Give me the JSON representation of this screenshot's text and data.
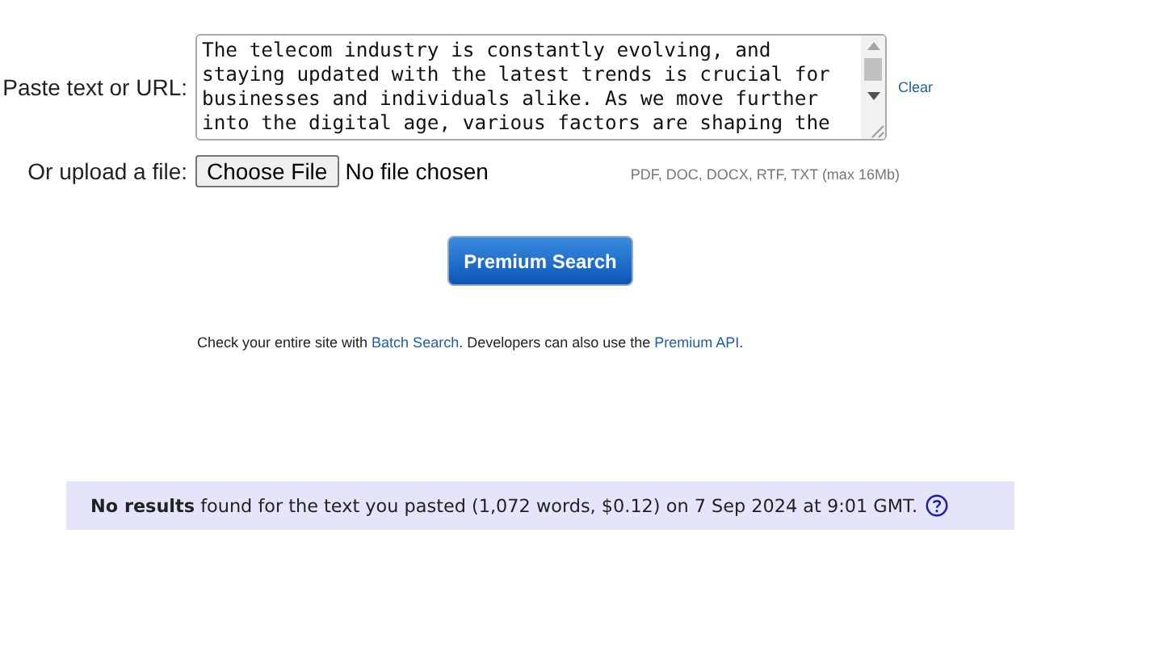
{
  "paste": {
    "label": "Paste text or URL:",
    "text_lines": [
      "The telecom industry is constantly evolving, and",
      "staying updated with the latest trends is crucial for",
      "businesses and individuals alike. As we move further",
      "into the digital age, various factors are shaping the"
    ],
    "clear": "Clear"
  },
  "upload": {
    "label": "Or upload a file:",
    "button": "Choose File",
    "status": "No file chosen",
    "formats": "PDF, DOC, DOCX, RTF, TXT (max 16Mb)"
  },
  "search_button": "Premium Search",
  "footnote": {
    "before": "Check your entire site with ",
    "link1": "Batch Search",
    "middle": ". Developers can also use the ",
    "link2": "Premium API",
    "after": "."
  },
  "result": "**No results** found for the text you pasted (1,072 words, $0.12) on 7 Sep 2024 at 9:01 GMT."
}
